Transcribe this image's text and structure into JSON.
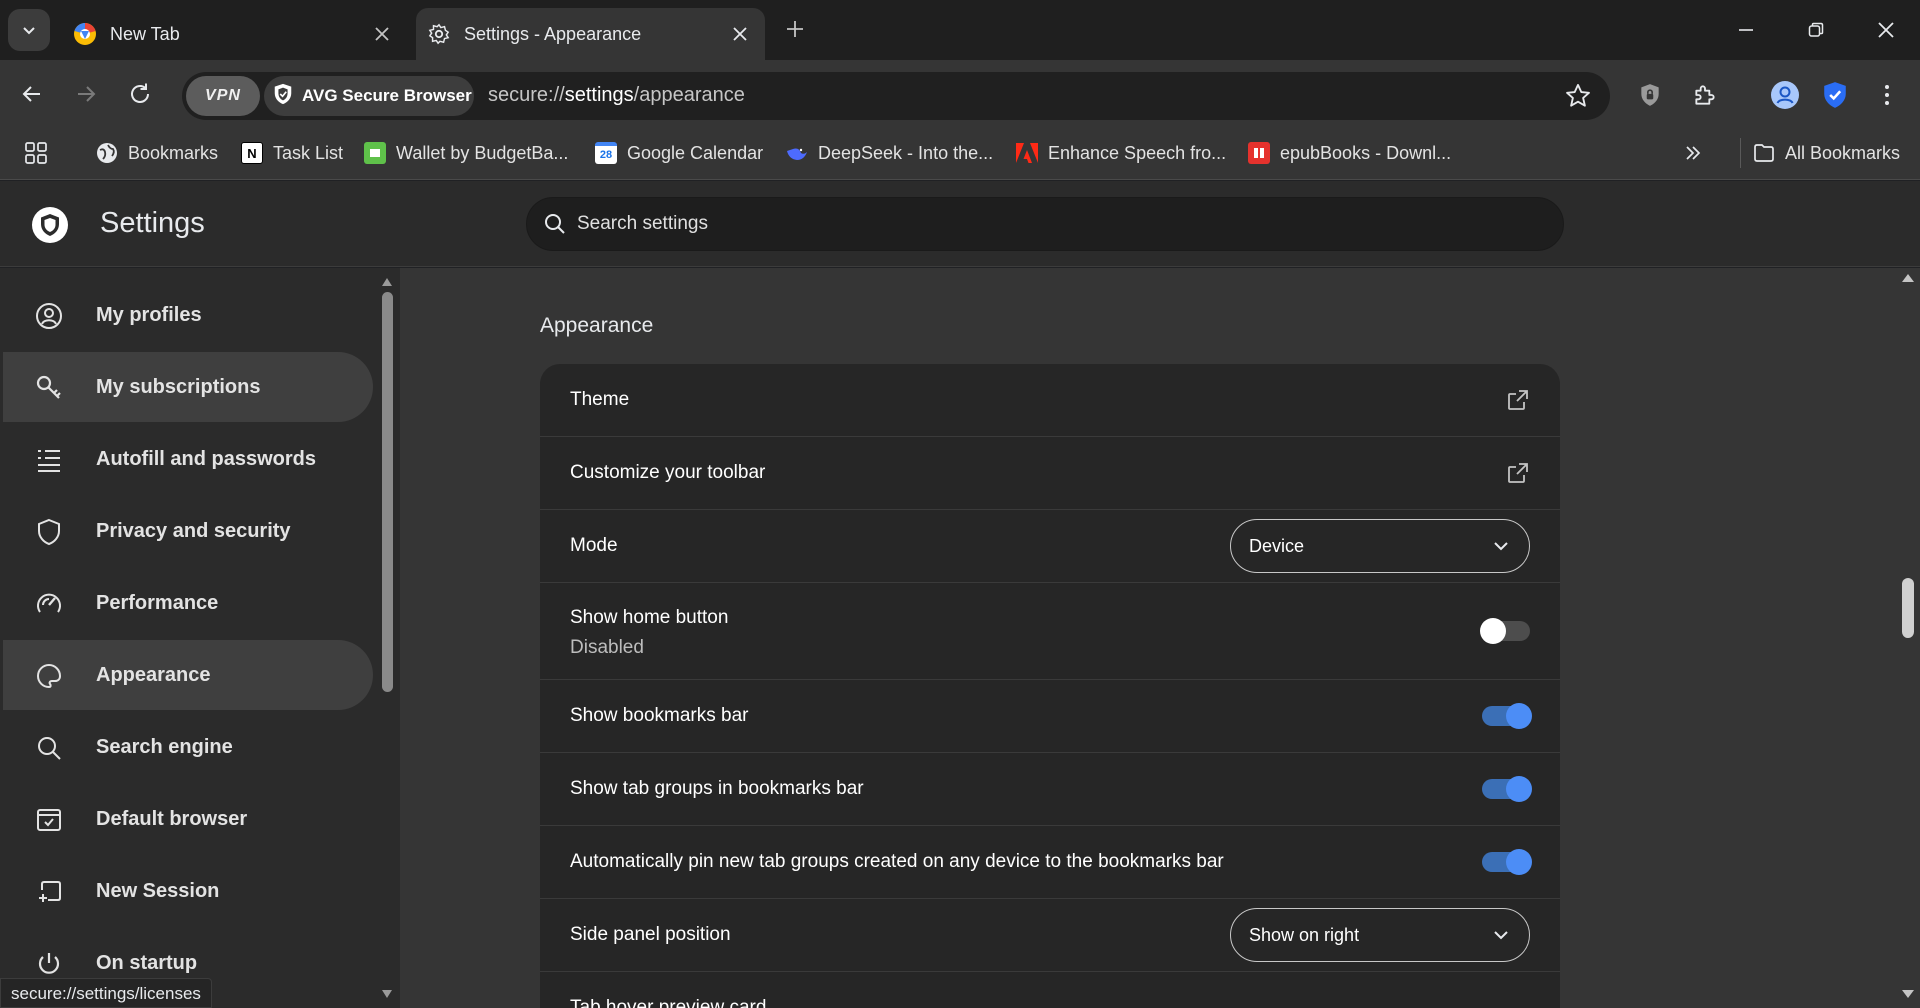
{
  "tabs": [
    {
      "title": "New Tab",
      "active": false
    },
    {
      "title": "Settings - Appearance",
      "active": true
    }
  ],
  "toolbar": {
    "vpn_label": "VPN",
    "browser_badge": "AVG Secure Browser",
    "url_scheme": "secure://",
    "url_host": "settings",
    "url_path": "/appearance"
  },
  "bookmarks": [
    {
      "label": "Bookmarks",
      "icon": "globe-icon"
    },
    {
      "label": "Task List",
      "icon": "notion-icon"
    },
    {
      "label": "Wallet by BudgetBa...",
      "icon": "wallet-icon"
    },
    {
      "label": "Google Calendar",
      "icon": "calendar-icon"
    },
    {
      "label": "DeepSeek - Into the...",
      "icon": "deepseek-icon"
    },
    {
      "label": "Enhance Speech fro...",
      "icon": "adobe-icon"
    },
    {
      "label": "epubBooks - Downl...",
      "icon": "epubbooks-icon"
    }
  ],
  "all_bookmarks_label": "All Bookmarks",
  "settings": {
    "title": "Settings",
    "search_placeholder": "Search settings"
  },
  "sidebar": {
    "items": [
      {
        "label": "My profiles",
        "icon": "profile-icon",
        "selected": false
      },
      {
        "label": "My subscriptions",
        "icon": "key-icon",
        "selected": true
      },
      {
        "label": "Autofill and passwords",
        "icon": "list-icon",
        "selected": false
      },
      {
        "label": "Privacy and security",
        "icon": "shield-icon",
        "selected": false
      },
      {
        "label": "Performance",
        "icon": "speedometer-icon",
        "selected": false
      },
      {
        "label": "Appearance",
        "icon": "palette-icon",
        "selected": true
      },
      {
        "label": "Search engine",
        "icon": "search-icon",
        "selected": false
      },
      {
        "label": "Default browser",
        "icon": "browser-icon",
        "selected": false
      },
      {
        "label": "New Session",
        "icon": "new-session-icon",
        "selected": false
      },
      {
        "label": "On startup",
        "icon": "power-icon",
        "selected": false
      }
    ]
  },
  "status_url": "secure://settings/licenses",
  "appearance": {
    "section_title": "Appearance",
    "rows": [
      {
        "label": "Theme",
        "control": "external-link"
      },
      {
        "label": "Customize your toolbar",
        "control": "external-link"
      },
      {
        "label": "Mode",
        "control": "dropdown",
        "value": "Device"
      },
      {
        "label": "Show home button",
        "sublabel": "Disabled",
        "control": "toggle",
        "on": false
      },
      {
        "label": "Show bookmarks bar",
        "control": "toggle",
        "on": true
      },
      {
        "label": "Show tab groups in bookmarks bar",
        "control": "toggle",
        "on": true
      },
      {
        "label": "Automatically pin new tab groups created on any device to the bookmarks bar",
        "control": "toggle",
        "on": true
      },
      {
        "label": "Side panel position",
        "control": "dropdown",
        "value": "Show on right"
      },
      {
        "label": "Tab hover preview card",
        "control": "none"
      }
    ]
  }
}
